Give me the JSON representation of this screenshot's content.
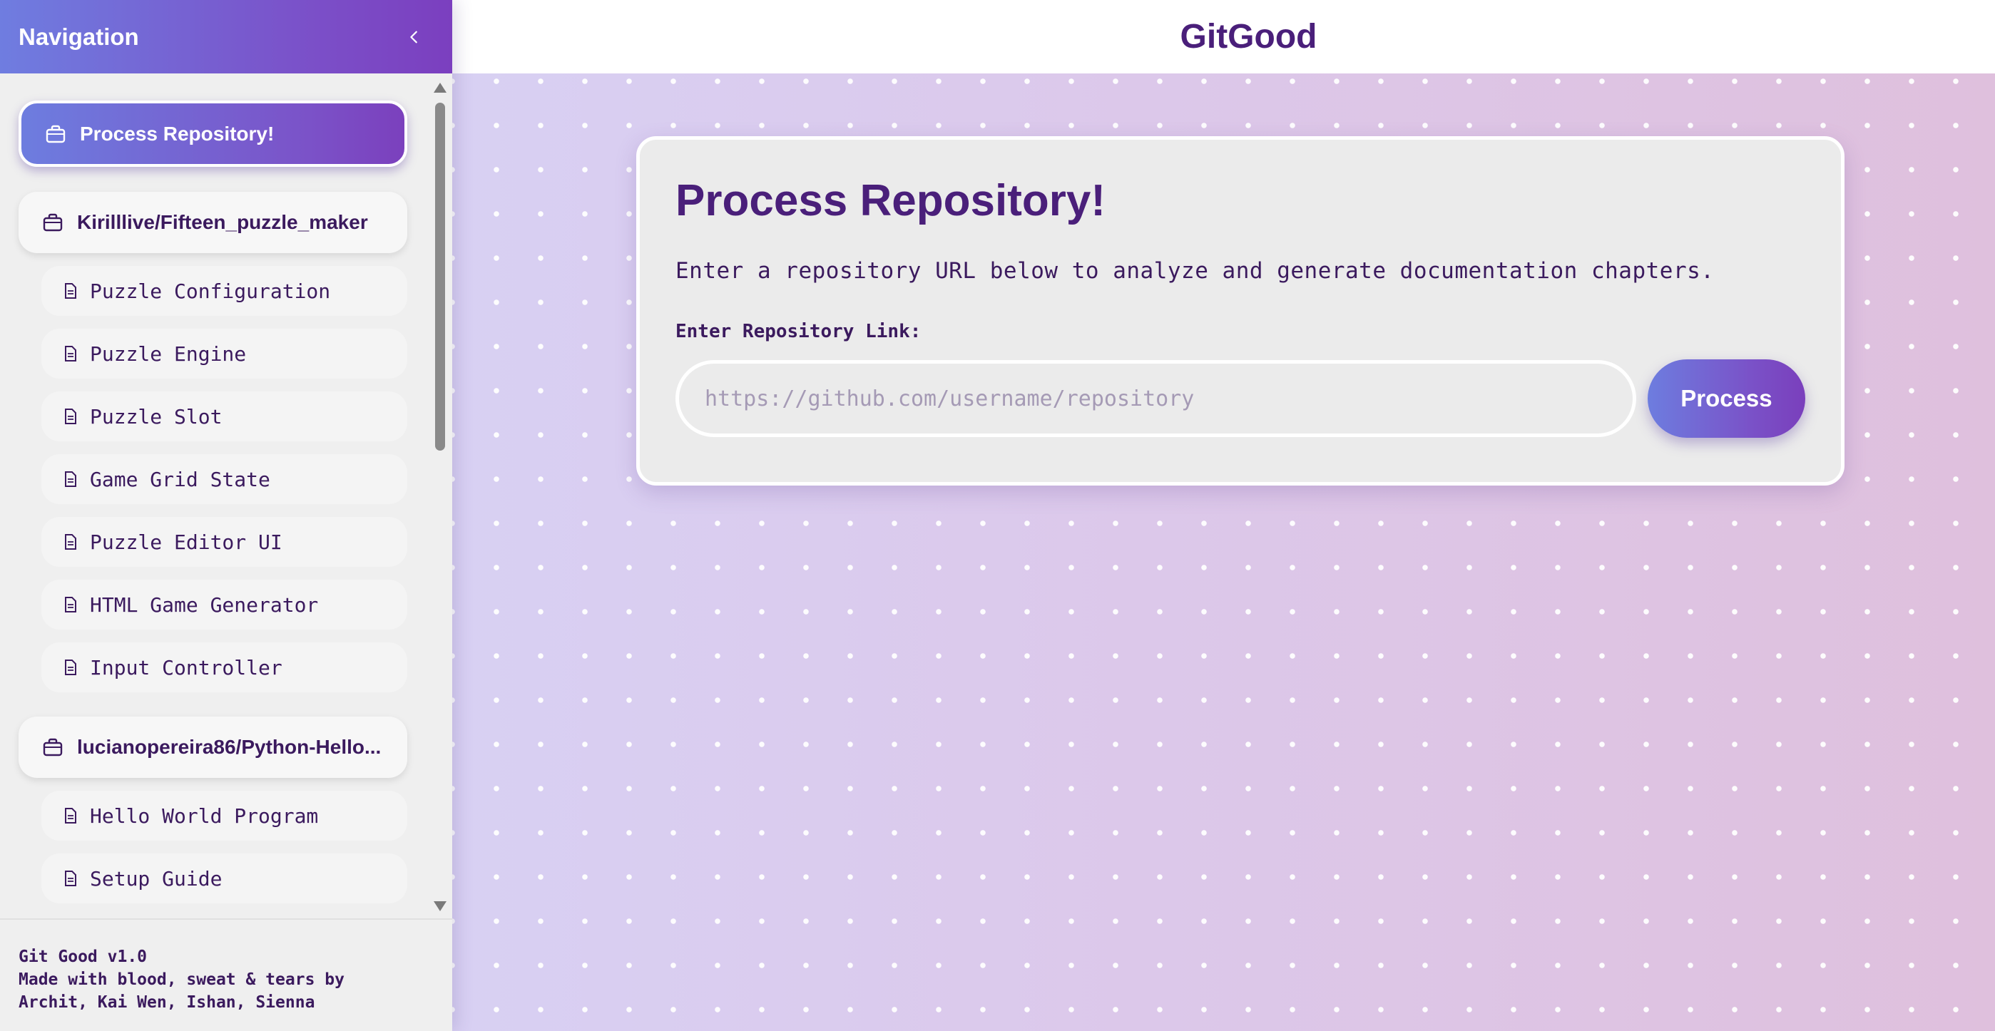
{
  "sidebar": {
    "title": "Navigation",
    "active_item": {
      "label": "Process Repository!",
      "icon": "folder-icon"
    },
    "repos": [
      {
        "label": "Kirilllive/Fifteen_puzzle_maker",
        "icon": "folder-icon",
        "chapters": [
          "Puzzle Configuration",
          "Puzzle Engine",
          "Puzzle Slot",
          "Game Grid State",
          "Puzzle Editor UI",
          "HTML Game Generator",
          "Input Controller"
        ]
      },
      {
        "label": "lucianopereira86/Python-Hello...",
        "icon": "folder-icon",
        "chapters": [
          "Hello World Program",
          "Setup Guide"
        ]
      }
    ],
    "footer": {
      "line1": "Git Good v1.0",
      "line2": "Made with blood, sweat & tears by",
      "line3": "Archit, Kai Wen, Ishan, Sienna"
    }
  },
  "header": {
    "app_title": "GitGood"
  },
  "main": {
    "card_title": "Process Repository!",
    "description": "Enter a repository URL below to analyze and generate documentation chapters.",
    "input_label": "Enter Repository Link:",
    "input_placeholder": "https://github.com/username/repository",
    "input_value": "",
    "button_label": "Process"
  },
  "colors": {
    "accent_start": "#6d7ddf",
    "accent_end": "#7b3fbf",
    "text_primary": "#3b1a5e",
    "title": "#4a1f7a"
  }
}
